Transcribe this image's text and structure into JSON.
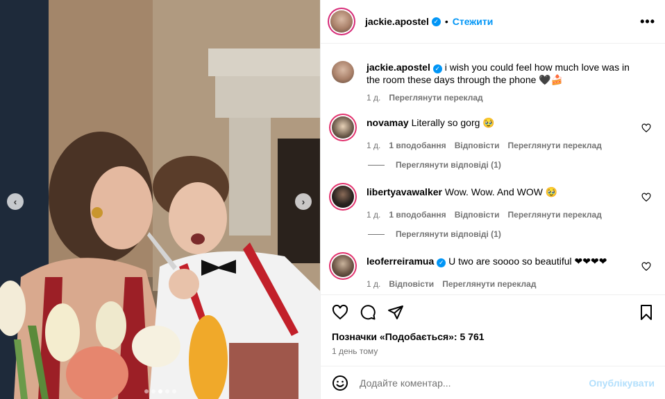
{
  "header": {
    "username": "jackie.apostel",
    "follow_label": "Стежити",
    "more_label": "•••"
  },
  "caption": {
    "username": "jackie.apostel",
    "text": "i wish you could feel how much love was in the room these days through the phone 🖤🍰",
    "time": "1 д.",
    "translate_label": "Переглянути переклад"
  },
  "comments": [
    {
      "username": "novamay",
      "text": "Literally so gorg 🥹",
      "time": "1 д.",
      "likes_label": "1 вподобання",
      "reply_label": "Відповісти",
      "translate_label": "Переглянути переклад",
      "view_replies_label": "Переглянути відповіді (1)"
    },
    {
      "username": "libertyavawalker",
      "text": "Wow. Wow. And WOW 🥹",
      "time": "1 д.",
      "likes_label": "1 вподобання",
      "reply_label": "Відповісти",
      "translate_label": "Переглянути переклад",
      "view_replies_label": "Переглянути відповіді (1)"
    },
    {
      "username": "leoferreiramua",
      "text": "U two are soooo so beautiful ❤❤❤❤",
      "time": "1 д.",
      "reply_label": "Відповісти",
      "translate_label": "Переглянути переклад"
    }
  ],
  "post": {
    "likes_text": "Позначки «Подобається»: 5 761",
    "time_ago": "1 день тому"
  },
  "composer": {
    "placeholder": "Додайте коментар...",
    "post_label": "Опублікувати"
  },
  "carousel": {
    "left_arrow": "‹",
    "right_arrow": "›",
    "slides_count": 5,
    "active_slide": 2
  },
  "colors": {
    "accent": "#0095f6",
    "verified": "#0095f6",
    "muted_text": "#737373",
    "post_disabled": "#b2dffc"
  }
}
